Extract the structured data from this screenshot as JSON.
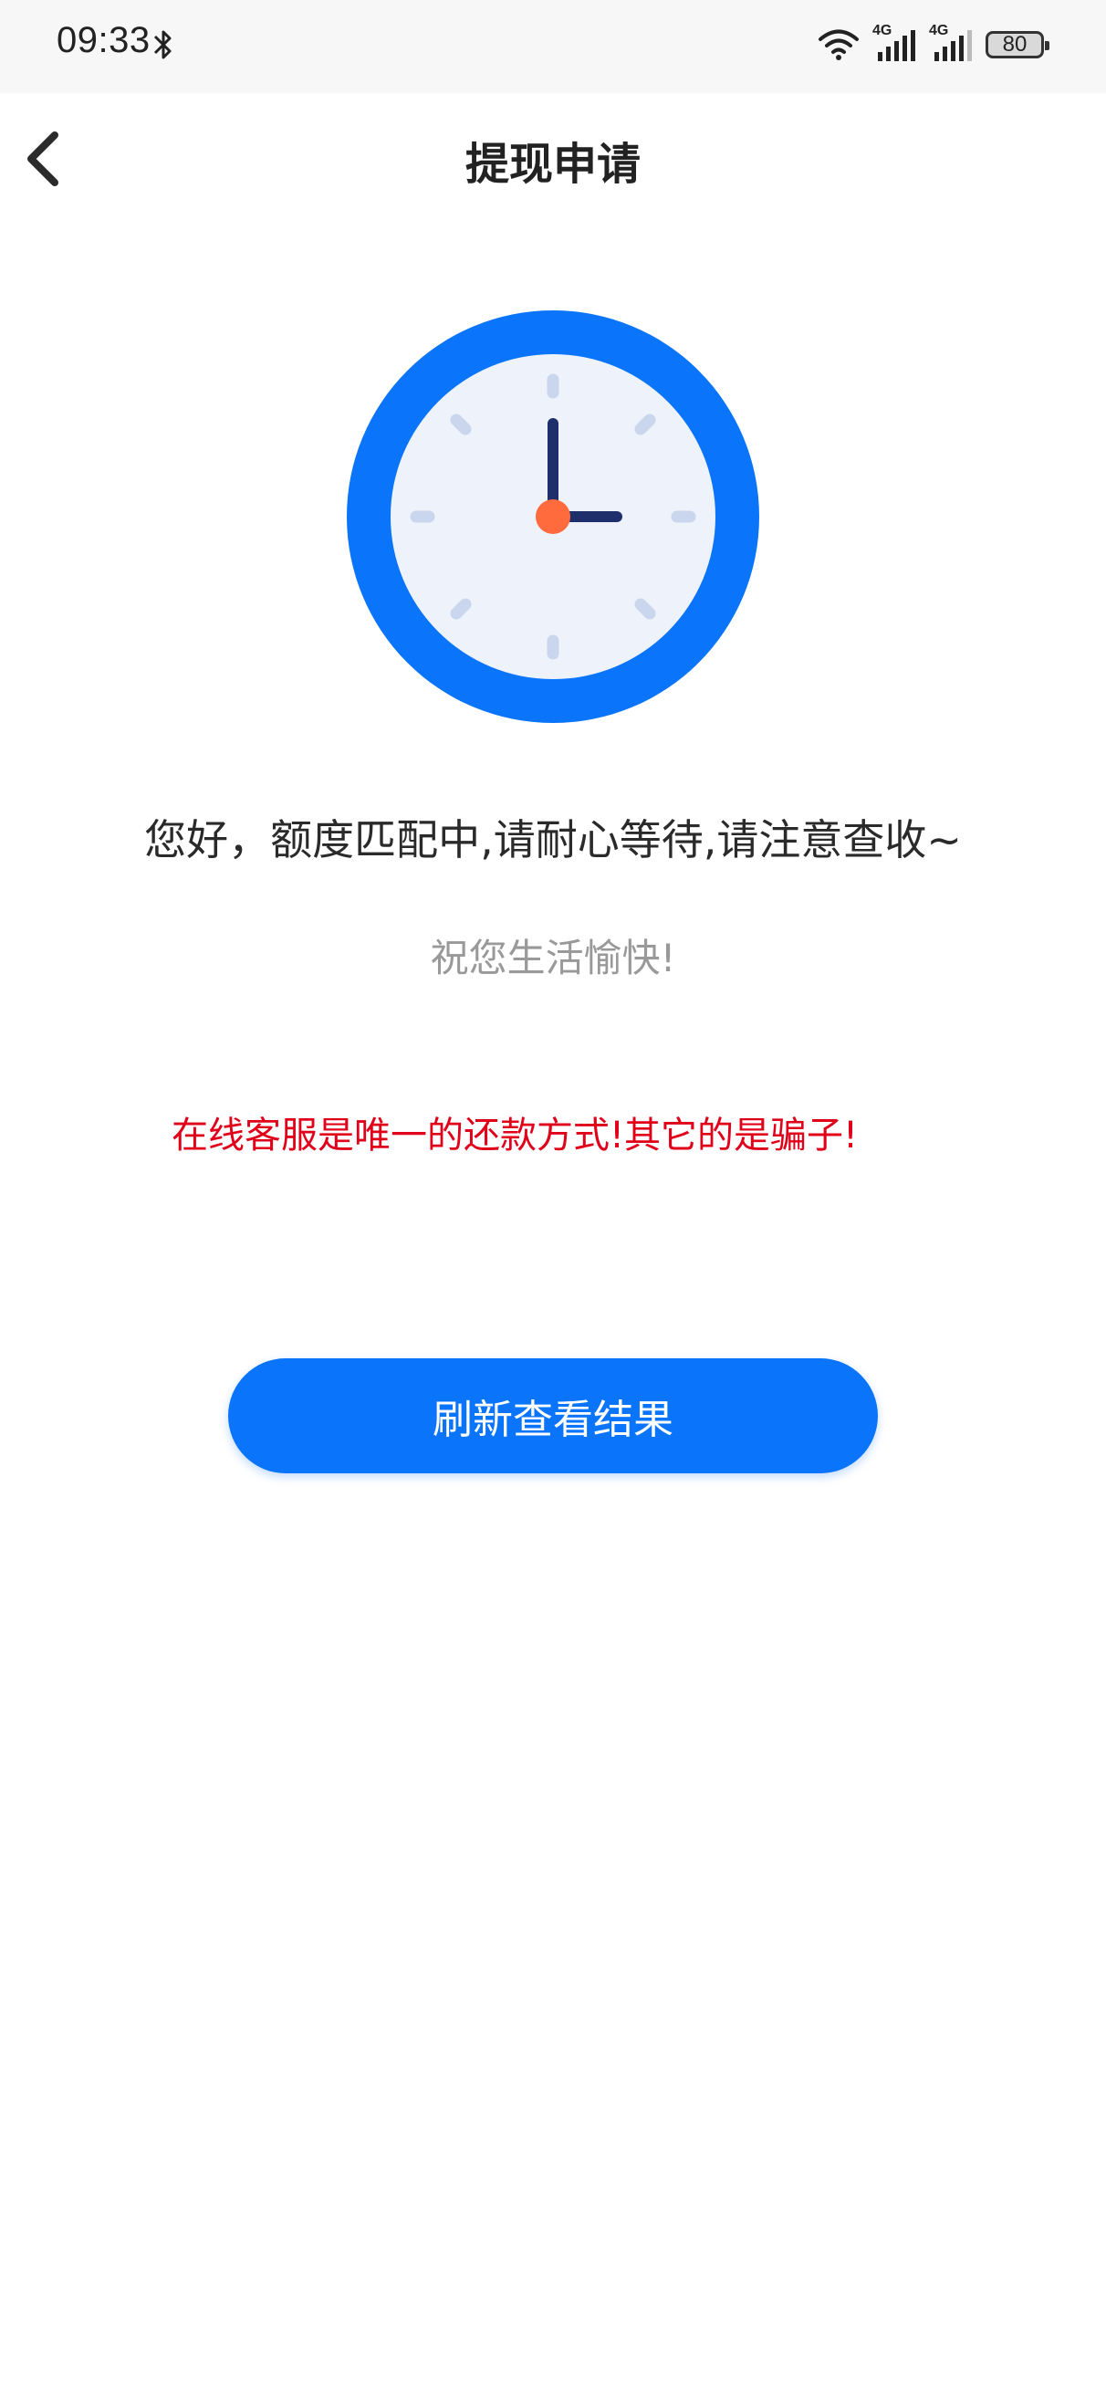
{
  "status_bar": {
    "time": "09:33",
    "battery": "80",
    "net1": "4G",
    "net2": "4G"
  },
  "header": {
    "title": "提现申请",
    "back_icon": "chevron-left-icon"
  },
  "content": {
    "illustration": "clock-icon",
    "message": "您好，额度匹配中,请耐心等待,请注意查收~",
    "sub_message": "祝您生活愉快!",
    "warning": "在线客服是唯一的还款方式!其它的是骗子!",
    "refresh_button": "刷新查看结果"
  },
  "colors": {
    "accent": "#0a74fb",
    "warning": "#e0001a",
    "clock_face": "#eef3fb",
    "clock_hand": "#1f2f6b",
    "clock_center": "#ff6b3d"
  }
}
